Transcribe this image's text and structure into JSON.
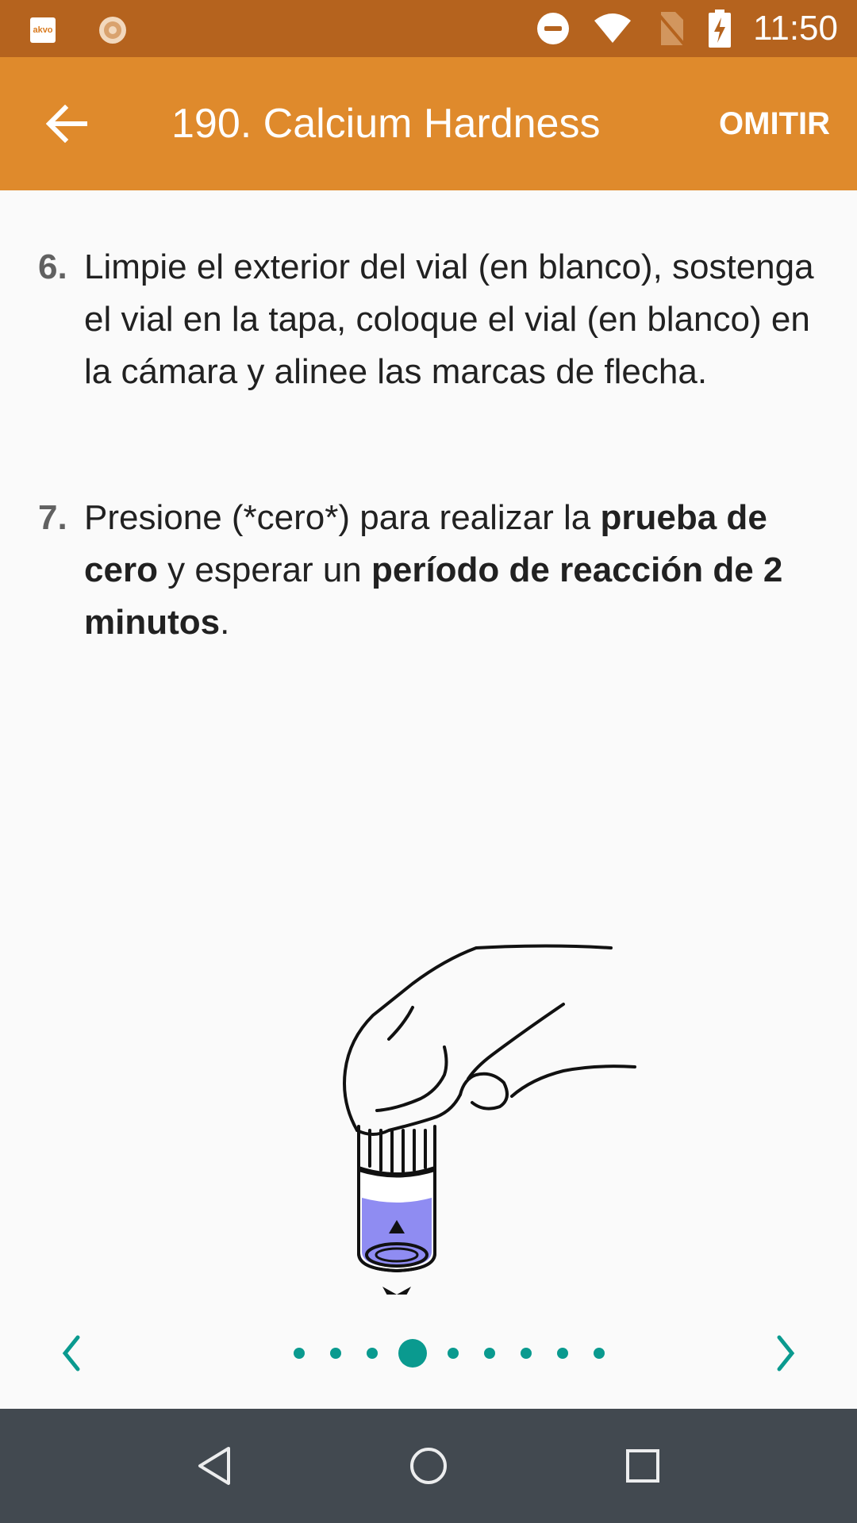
{
  "status_bar": {
    "time": "11:50",
    "app_icon_label": "akvo",
    "icons": [
      "akvo-app-icon",
      "sun-app-icon",
      "do-not-disturb-icon",
      "wifi-icon",
      "no-sim-icon",
      "battery-charging-icon"
    ]
  },
  "app_bar": {
    "title": "190. Calcium Hardness",
    "back_icon": "arrow-back-icon",
    "skip_label": "OMITIR"
  },
  "steps": [
    {
      "number": "6.",
      "text": "Limpie el exterior del vial (en blanco), sostenga el vial en la tapa, coloque el vial (en blanco) en la cámara y alinee las marcas de flecha."
    },
    {
      "number": "7.",
      "parts": [
        "Presione (*cero*) para realizar la ",
        "prueba de cero",
        " y esperar un ",
        "período de reacción de 2 minutos",
        "."
      ]
    }
  ],
  "pager": {
    "total_pages": 9,
    "current_index": 3,
    "prev_icon": "chevron-left-icon",
    "next_icon": "chevron-right-icon"
  },
  "colors": {
    "status_bar": "#b5631e",
    "app_bar": "#df8a2c",
    "accent": "#0a9a8f",
    "vial_liquid": "#8f8cf2",
    "nav_bar": "#424950"
  },
  "nav_bar": {
    "icons": [
      "back-triangle-icon",
      "home-circle-icon",
      "recents-square-icon"
    ]
  }
}
